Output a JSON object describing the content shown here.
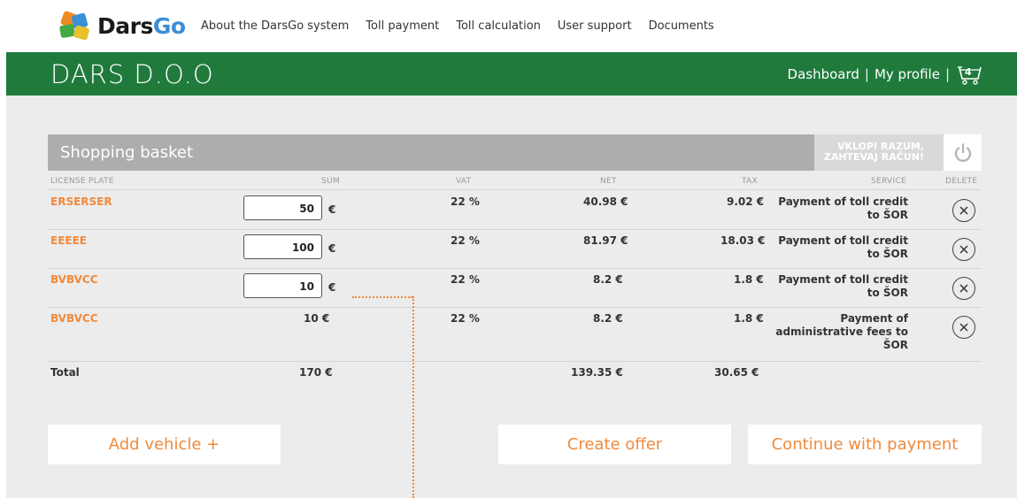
{
  "logo": {
    "part1": "Dars",
    "part2": "Go"
  },
  "nav": [
    "About the DarsGo system",
    "Toll payment",
    "Toll calculation",
    "User support",
    "Documents"
  ],
  "header": {
    "company": "DARS D.O.O",
    "dashboard": "Dashboard",
    "separator": "|",
    "profile": "My profile",
    "cart_count": "4"
  },
  "basket": {
    "title": "Shopping basket",
    "invoice_toggle": "VKLOPI RAZUM, ZAHTEVAJ RAČUN!",
    "columns": {
      "plate": "LICENSE PLATE",
      "sum": "SUM",
      "vat": "VAT",
      "net": "NET",
      "tax": "TAX",
      "service": "SERVICE",
      "delete": "DELETE"
    },
    "rows": [
      {
        "plate": "ERSERSER",
        "sum": "50",
        "currency": "€",
        "vat": "22 %",
        "net": "40.98 €",
        "tax": "9.02 €",
        "service": "Payment of toll credit to ŠOR"
      },
      {
        "plate": "EEEEE",
        "sum": "100",
        "currency": "€",
        "vat": "22 %",
        "net": "81.97 €",
        "tax": "18.03 €",
        "service": "Payment of toll credit to ŠOR"
      },
      {
        "plate": "BVBVCC",
        "sum": "10",
        "currency": "€",
        "vat": "22 %",
        "net": "8.2 €",
        "tax": "1.8 €",
        "service": "Payment of toll credit to ŠOR"
      },
      {
        "plate": "BVBVCC",
        "sum": "10 €",
        "vat": "22 %",
        "net": "8.2 €",
        "tax": "1.8 €",
        "service": "Payment of administrative fees to ŠOR"
      }
    ],
    "total": {
      "label": "Total",
      "sum": "170 €",
      "net": "139.35 €",
      "tax": "30.65 €"
    }
  },
  "buttons": {
    "add_vehicle": "Add vehicle +",
    "create_offer": "Create offer",
    "continue_payment": "Continue with payment"
  },
  "colors": {
    "green": "#1f7a3c",
    "orange": "#f08a3c",
    "gray_bg": "#ececec"
  }
}
